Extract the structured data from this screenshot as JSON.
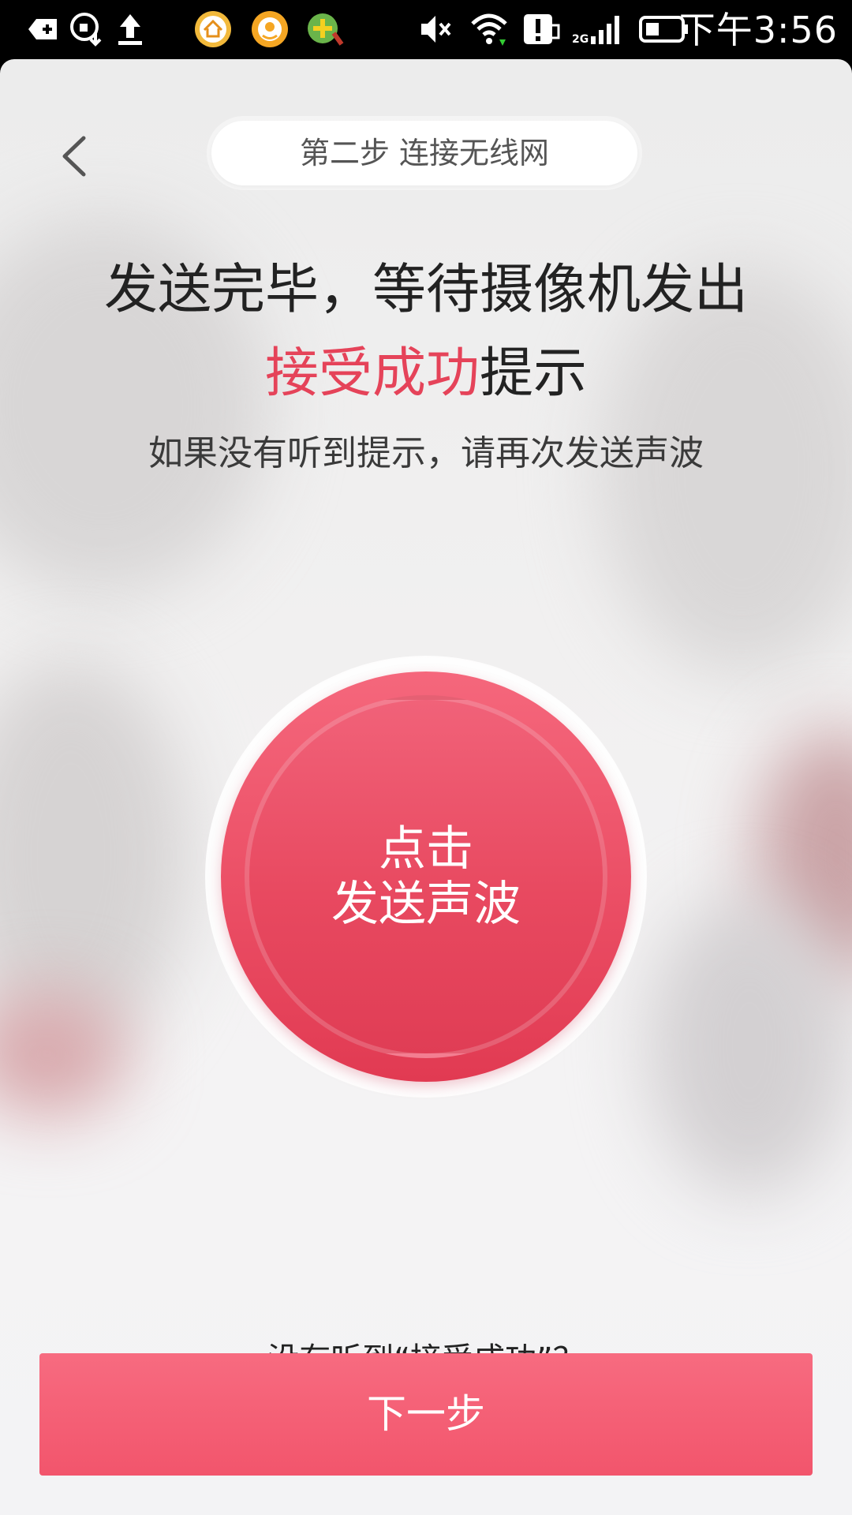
{
  "status_bar": {
    "time": "下午3:56",
    "network_label": "2G",
    "icons": [
      "add-icon",
      "phone-download-icon",
      "upload-icon",
      "home-app-icon",
      "flower-app-icon",
      "plus-app-icon",
      "mute-icon",
      "wifi-icon",
      "alert-icon",
      "signal-icon",
      "battery-icon"
    ]
  },
  "header": {
    "back_icon": "chevron-left-icon",
    "step_title": "第二步 连接无线网"
  },
  "main": {
    "headline_line1": "发送完毕，等待摄像机发出",
    "headline_accent": "接受成功",
    "headline_line2_suffix": "提示",
    "subtitle": "如果没有听到提示，请再次发送声波",
    "send_button_line1": "点击",
    "send_button_line2": "发送声波"
  },
  "footer": {
    "help_link": "没有听到“接受成功”？",
    "next_button": "下一步"
  },
  "colors": {
    "accent": "#e54359",
    "button": "#f2556c"
  }
}
